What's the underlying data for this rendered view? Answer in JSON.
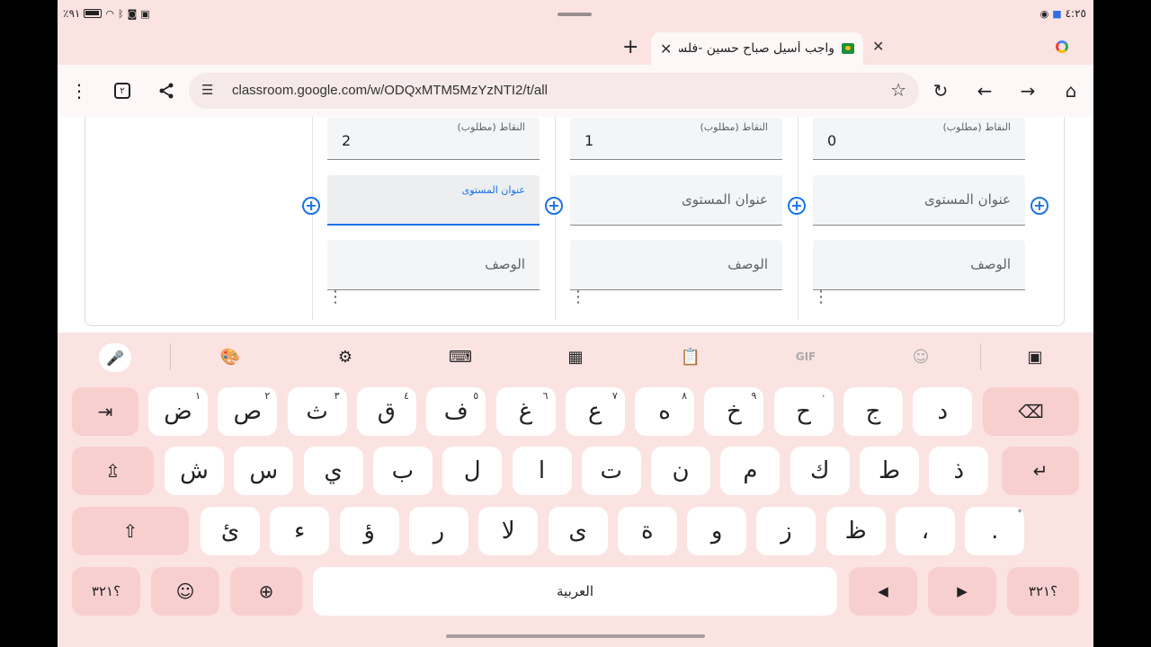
{
  "status": {
    "battery": "٪٩١",
    "time": "٤:٢٥"
  },
  "browser": {
    "active_tab_title": "واجب أسيل صباح حسين -فلسفة",
    "url": "classroom.google.com/w/ODQxMTM5MzYzNTI2/t/all",
    "tab_count": "٢"
  },
  "rubric": {
    "columns": [
      {
        "points_label": "النقاط (مطلوب)",
        "points": "0",
        "title_placeholder": "عنوان المستوى",
        "desc_placeholder": "الوصف"
      },
      {
        "points_label": "النقاط (مطلوب)",
        "points": "1",
        "title_placeholder": "عنوان المستوى",
        "desc_placeholder": "الوصف"
      },
      {
        "points_label": "النقاط (مطلوب)",
        "points": "2",
        "title_label": "عنوان المستوى",
        "desc_placeholder": "الوصف"
      }
    ]
  },
  "keyboard": {
    "row1": [
      {
        "c": "ض",
        "h": "١"
      },
      {
        "c": "ص",
        "h": "٢"
      },
      {
        "c": "ث",
        "h": "٣"
      },
      {
        "c": "ق",
        "h": "٤"
      },
      {
        "c": "ف",
        "h": "٥"
      },
      {
        "c": "غ",
        "h": "٦"
      },
      {
        "c": "ع",
        "h": "٧"
      },
      {
        "c": "ه",
        "h": "٨"
      },
      {
        "c": "خ",
        "h": "٩"
      },
      {
        "c": "ح",
        "h": "٠"
      },
      {
        "c": "ج",
        "h": ""
      },
      {
        "c": "د",
        "h": ""
      }
    ],
    "row2": [
      "ش",
      "س",
      "ي",
      "ب",
      "ل",
      "ا",
      "ت",
      "ن",
      "م",
      "ك",
      "ط",
      "ذ"
    ],
    "row3": [
      "ئ",
      "ء",
      "ؤ",
      "ر",
      "لا",
      "ى",
      "ة",
      "و",
      "ز",
      "ظ",
      "،",
      "."
    ],
    "row3_last_hint": "ْ",
    "symbols_label": "؟٣٢١",
    "space_label": "العربية",
    "gif_label": "GIF"
  }
}
